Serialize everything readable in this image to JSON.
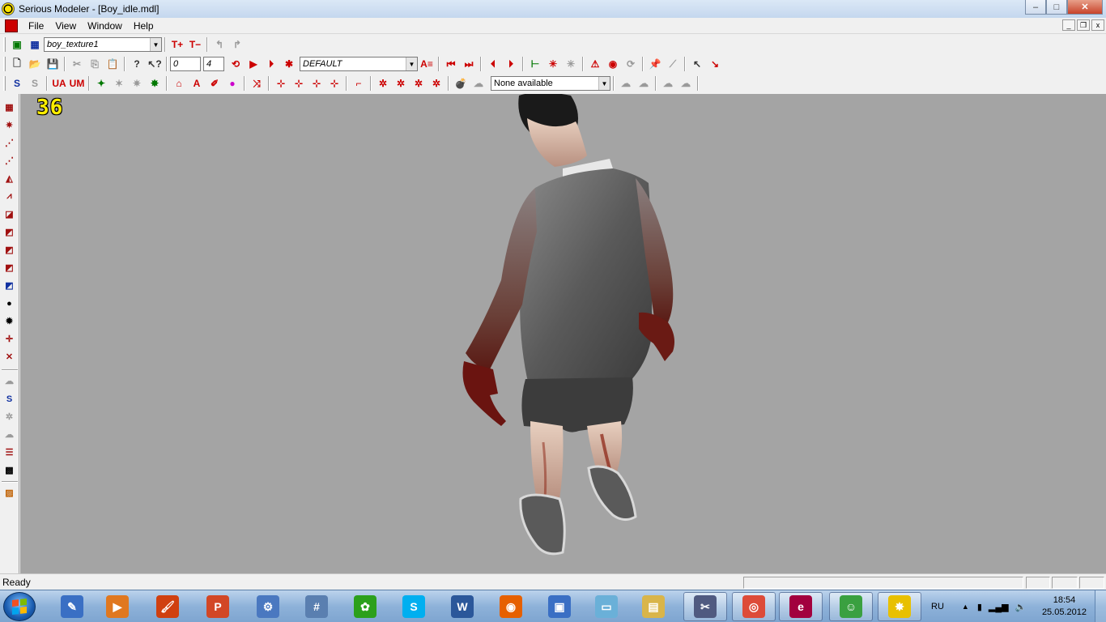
{
  "window": {
    "title": "Serious Modeler - [Boy_idle.mdl]",
    "controls": {
      "minimize": "–",
      "maximize": "□",
      "close": "✕"
    }
  },
  "menubar": {
    "items": [
      "File",
      "View",
      "Window",
      "Help"
    ],
    "mdi_controls": {
      "minimize": "_",
      "restore": "❐",
      "close": "x"
    }
  },
  "toolbar1": {
    "texture_combo": "boy_texture1"
  },
  "toolbar2": {
    "frame_start": "0",
    "frame_end": "4",
    "animation_combo": "DEFAULT"
  },
  "toolbar3": {
    "sound_combo": "None available",
    "labels": {
      "s_icon": "S",
      "u_a": "UA",
      "u_m": "UM"
    }
  },
  "viewport": {
    "frame_counter": "36",
    "background_color": "#a4a4a4",
    "model_subject": "zombie-boy-model"
  },
  "statusbar": {
    "text": "Ready"
  },
  "taskbar": {
    "apps": [
      {
        "name": "designer-app-icon",
        "glyph": "✎",
        "color": "#3a6fc4"
      },
      {
        "name": "media-player-icon",
        "glyph": "▶",
        "color": "#e07820"
      },
      {
        "name": "paint-icon",
        "glyph": "🖌",
        "color": "#d04010"
      },
      {
        "name": "powerpoint-icon",
        "glyph": "P",
        "color": "#d24726"
      },
      {
        "name": "settings-app-icon",
        "glyph": "⚙",
        "color": "#4a78c0"
      },
      {
        "name": "calculator-icon",
        "glyph": "#",
        "color": "#5a7fb0"
      },
      {
        "name": "icq-icon",
        "glyph": "✿",
        "color": "#2ca01c"
      },
      {
        "name": "skype-icon",
        "glyph": "S",
        "color": "#00aff0"
      },
      {
        "name": "word-icon",
        "glyph": "W",
        "color": "#2b579a"
      },
      {
        "name": "firefox-icon",
        "glyph": "◉",
        "color": "#e66000"
      },
      {
        "name": "remote-desktop-icon",
        "glyph": "▣",
        "color": "#3a6fc4"
      },
      {
        "name": "notepad-icon",
        "glyph": "▭",
        "color": "#6ab0d8"
      },
      {
        "name": "explorer-icon",
        "glyph": "▤",
        "color": "#d9b54a"
      },
      {
        "name": "modeler-tool-icon",
        "glyph": "✂",
        "color": "#505a80"
      },
      {
        "name": "chrome-icon",
        "glyph": "◎",
        "color": "#dd4b39"
      },
      {
        "name": "erlang-icon",
        "glyph": "e",
        "color": "#a2003e"
      },
      {
        "name": "game-app-icon",
        "glyph": "☺",
        "color": "#3aa040"
      },
      {
        "name": "serious-modeler-icon",
        "glyph": "✸",
        "color": "#e8c000"
      }
    ],
    "tray_language": "RU",
    "tray_arrow": "▲",
    "clock_time": "18:54",
    "clock_date": "25.05.2012"
  }
}
